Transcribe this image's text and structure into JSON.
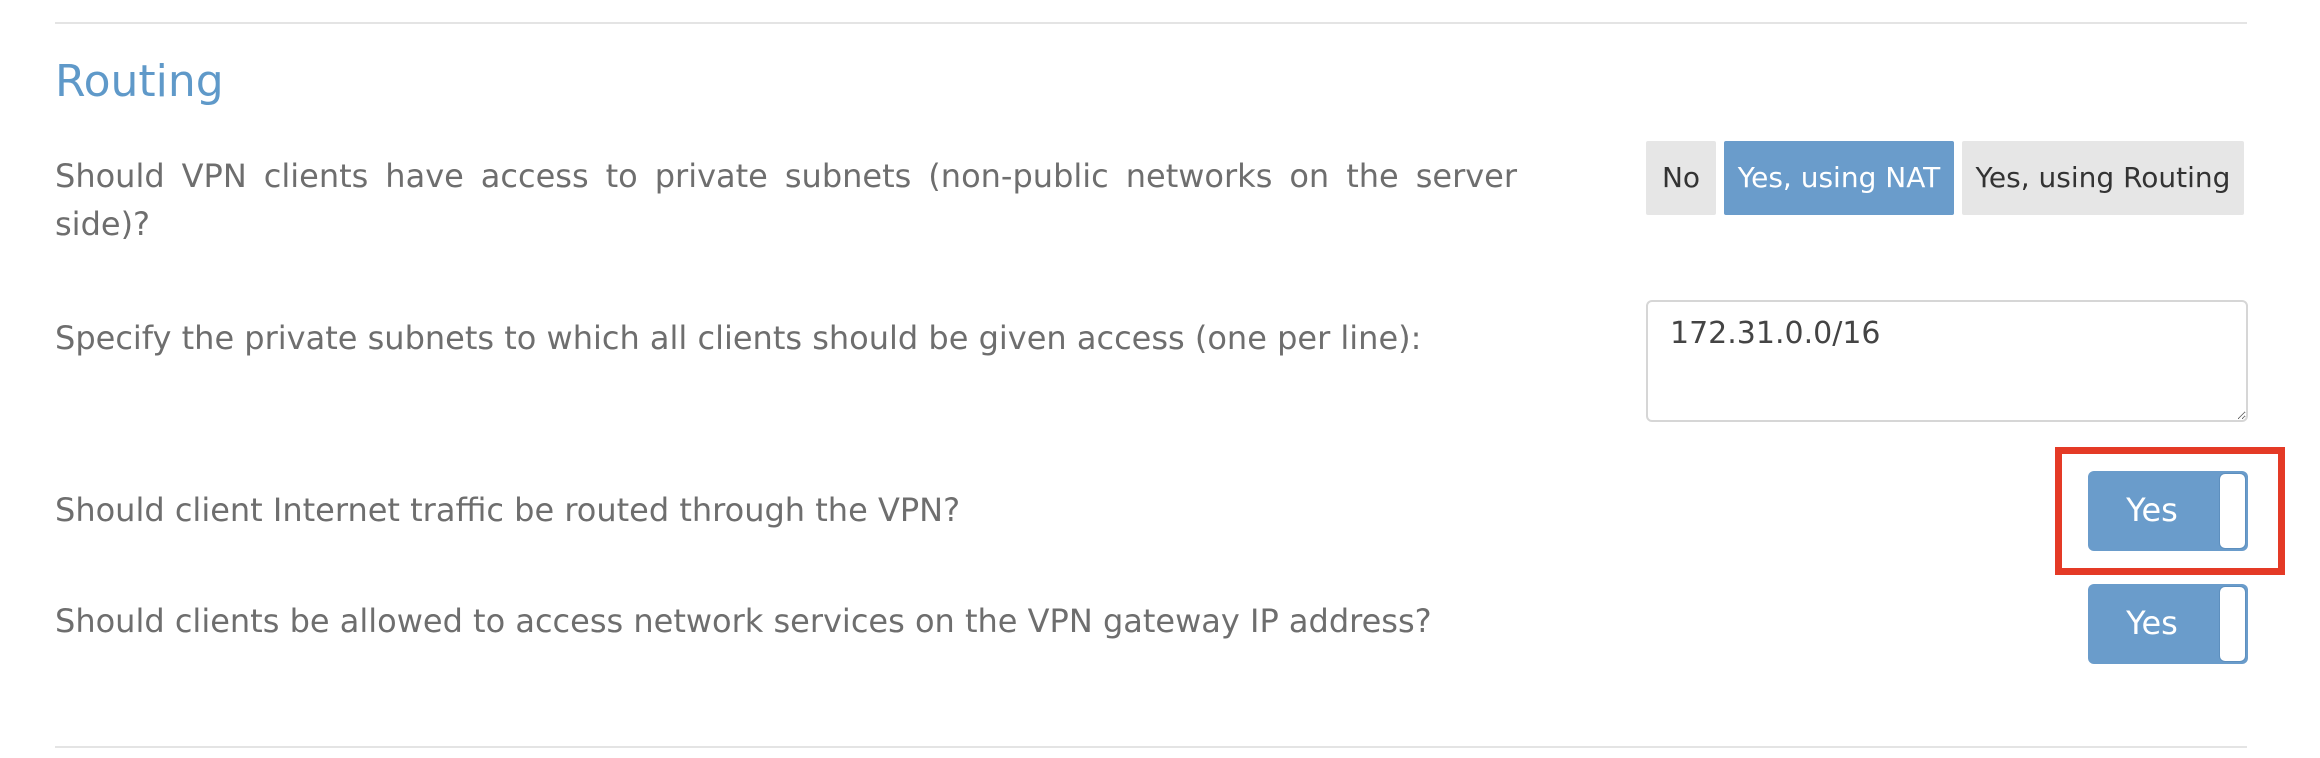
{
  "section": {
    "title": "Routing"
  },
  "routing": {
    "private_access_question": "Should VPN clients have access to private subnets (non-public networks on the server side)?",
    "options": [
      {
        "label": "No",
        "active": false
      },
      {
        "label": "Yes, using NAT",
        "active": true
      },
      {
        "label": "Yes, using Routing",
        "active": false
      }
    ],
    "subnets_question": "Specify the private subnets to which all clients should be given access (one per line):",
    "subnets_value": "172.31.0.0/16",
    "internet_question": "Should client Internet traffic be routed through the VPN?",
    "internet_toggle_label": "Yes",
    "gateway_question": "Should clients be allowed to access network services on the VPN gateway IP address?",
    "gateway_toggle_label": "Yes"
  },
  "colors": {
    "accent": "#6a9ccb",
    "title": "#5f99c9",
    "highlight": "#e43a26"
  }
}
